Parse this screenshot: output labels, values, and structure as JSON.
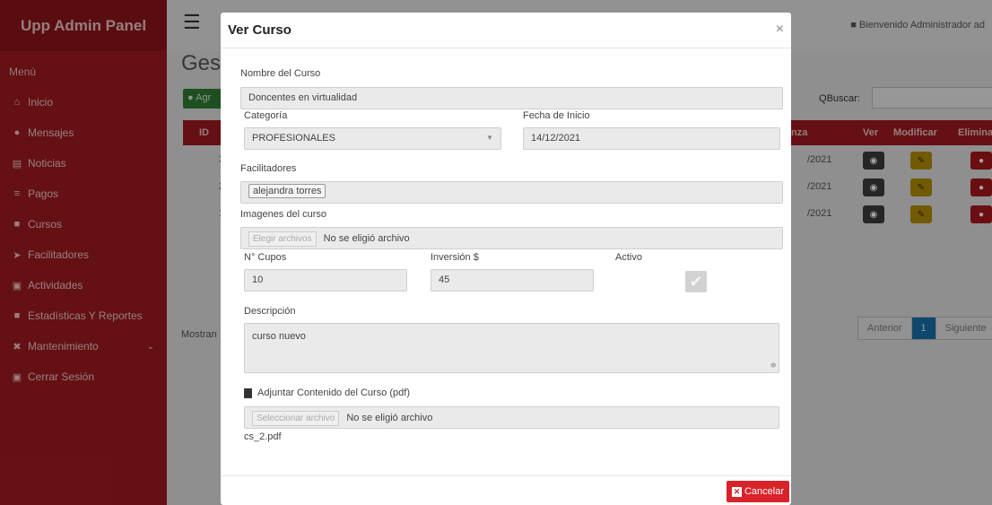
{
  "sidebar": {
    "brand": "Upp Admin Panel",
    "menu_title": "Menú",
    "items": [
      {
        "label": "Inicio",
        "icon": "home-icon",
        "glyph": "⌂"
      },
      {
        "label": "Mensajes",
        "icon": "comment-icon",
        "glyph": "●"
      },
      {
        "label": "Noticias",
        "icon": "newspaper-icon",
        "glyph": "▤"
      },
      {
        "label": "Pagos",
        "icon": "money-icon",
        "glyph": "≡"
      },
      {
        "label": "Cursos",
        "icon": "book-icon",
        "glyph": "■"
      },
      {
        "label": "Facilitadores",
        "icon": "user-tie-icon",
        "glyph": "➤"
      },
      {
        "label": "Actividades",
        "icon": "image-icon",
        "glyph": "▣"
      },
      {
        "label": "Estadísticas Y Reportes",
        "icon": "file-chart-icon",
        "glyph": "■"
      },
      {
        "label": "Mantenimiento",
        "icon": "wrench-icon",
        "glyph": "✖"
      },
      {
        "label": "Cerrar Sesión",
        "icon": "sign-out-icon",
        "glyph": "▣"
      }
    ]
  },
  "topbar": {
    "welcome": "Bienvenido Administrador ad"
  },
  "main": {
    "title": "Gest",
    "add_button": "Agr",
    "search_label": "Buscar:",
    "columns": {
      "id": "ID",
      "date": "nza",
      "ver": "Ver",
      "modificar": "Modificar",
      "eliminar": "Eliminar"
    },
    "rows": [
      {
        "id": "3",
        "date": "/2021"
      },
      {
        "id": "2",
        "date": "/2021"
      },
      {
        "id": "1",
        "date": "/2021"
      }
    ],
    "showing": "Mostran",
    "pager": {
      "prev": "Anterior",
      "current": "1",
      "next": "Siguiente"
    }
  },
  "modal": {
    "title": "Ver Curso",
    "close": "×",
    "nombre_label": "Nombre del Curso",
    "nombre_value": "Doncentes en virtualidad",
    "categoria_label": "Categoría",
    "categoria_value": "PROFESIONALES",
    "fecha_label": "Fecha de Inicio",
    "fecha_value": "14/12/2021",
    "facilitadores_label": "Facilitadores",
    "facilitador_tag": "alejandra torres",
    "imagenes_label": "Imagenes del curso",
    "imagenes_button": "Elegir archivos",
    "imagenes_status": "No se eligió archivo",
    "cupos_label": "N° Cupos",
    "cupos_value": "10",
    "inversion_label": "Inversión $",
    "inversion_value": "45",
    "activo_label": "Activo",
    "activo_checked": true,
    "descripcion_label": "Descripción",
    "descripcion_value": "curso nuevo",
    "adjuntar_label": "Adjuntar Contenido del Curso (pdf)",
    "adjuntar_button": "Seleccionar archivo",
    "adjuntar_status": "No se eligió archivo",
    "adjuntar_filename": "cs_2.pdf",
    "cancel_label": "Cancelar"
  },
  "colors": {
    "sidebar": "#9c1a1f",
    "cancel": "#d9232a"
  }
}
